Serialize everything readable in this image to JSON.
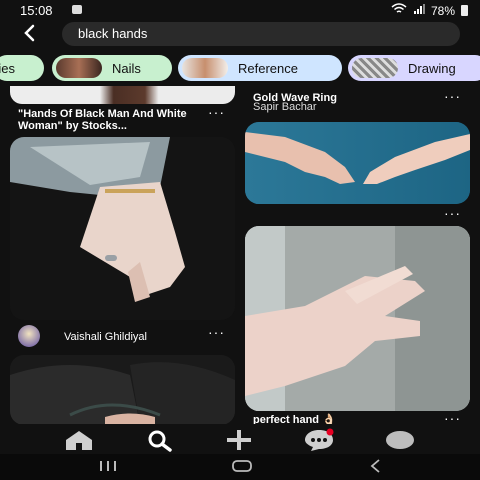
{
  "status": {
    "time": "15:08",
    "battery": "78%"
  },
  "search": {
    "query": "black hands"
  },
  "chips": [
    {
      "label": "ries"
    },
    {
      "label": "Nails"
    },
    {
      "label": "Reference"
    },
    {
      "label": "Drawing"
    }
  ],
  "pins": {
    "left_top": {
      "title": "\"Hands Of Black Man And White Woman\" by Stocks..."
    },
    "right_top": {
      "title": "Gold Wave Ring",
      "author": "Sapir Bachar"
    },
    "left_mid": {
      "author": "Vaishali Ghildiyal"
    },
    "right_bottom": {
      "title": "perfect hand 👌🏻"
    }
  },
  "more_label": "···",
  "colors": {
    "background": "#111111",
    "chip_green": "#c8f0cf",
    "chip_lavender": "#d8d6ff",
    "chip_blue": "#cfe5ff"
  },
  "icons": [
    "back-arrow-icon",
    "home-icon",
    "search-icon",
    "plus-icon",
    "chat-icon",
    "profile-icon"
  ]
}
